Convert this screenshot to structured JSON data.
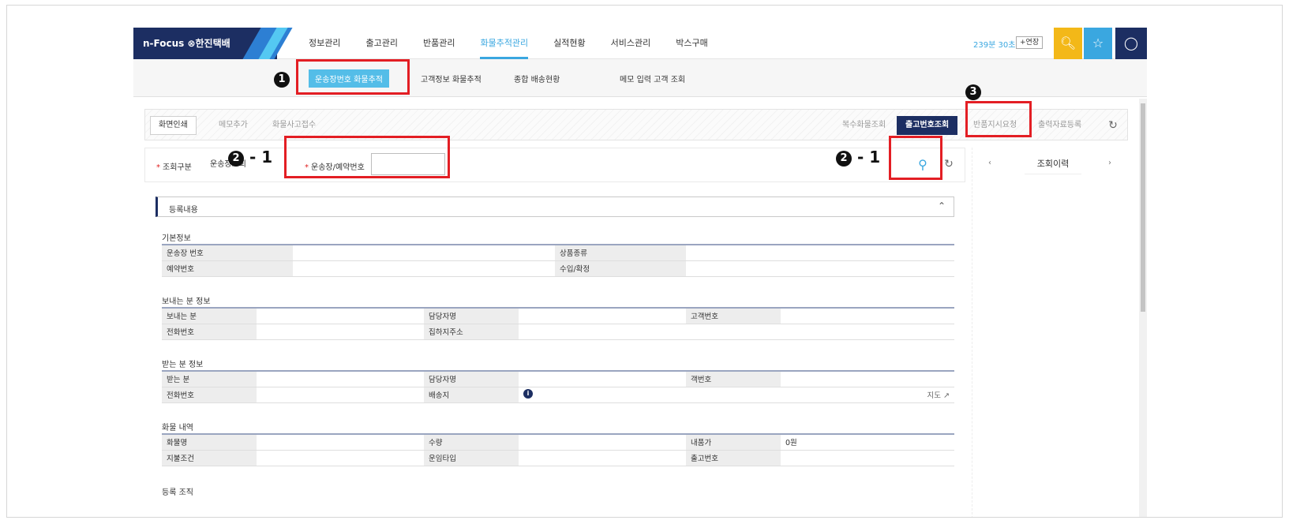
{
  "header": {
    "logo": "n-Focus ⊗한진택배",
    "nav": [
      "정보관리",
      "출고관리",
      "반품관리",
      "화물추적관리",
      "실적현황",
      "서비스관리",
      "박스구매"
    ],
    "active_nav": "화물추적관리",
    "session_timer": "239분 30초",
    "extend_label": "+연장",
    "icons": [
      "search-icon",
      "star-icon",
      "user-icon"
    ],
    "colors": {
      "navy": "#1c2e62",
      "sky": "#3aa7e0",
      "yellow": "#f3b818"
    }
  },
  "subnav": {
    "items": [
      "운송장번호 화물추적",
      "고객정보 화물추적",
      "종합 배송현황",
      "메모 입력 고객 조회"
    ]
  },
  "toolbar": {
    "left": [
      "화면인쇄",
      "메모추가",
      "화물사고접수"
    ],
    "right": [
      "복수화물조회",
      "출고번호조회",
      "반품지시요청",
      "출력자료등록"
    ]
  },
  "search": {
    "type_label": "조회구분",
    "type_value": "운송장조회",
    "waybill_label": "운송장/예약번호",
    "waybill_value": ""
  },
  "right_panel": {
    "history_label": "조회이력"
  },
  "content": {
    "section_title": "등록내용",
    "groups": {
      "basic": {
        "title": "기본정보",
        "waybill": "운송장 번호",
        "product_type": "상품종류",
        "reservation": "예약번호",
        "import_confirm": "수입/확정"
      },
      "sender": {
        "title": "보내는 분 정보",
        "sender": "보내는 분",
        "manager": "담당자명",
        "customer_no": "고객번호",
        "phone": "전화번호",
        "pickup_addr": "집하지주소"
      },
      "receiver": {
        "title": "받는 분 정보",
        "receiver": "받는 분",
        "manager": "담당자명",
        "customer_no": "객번호",
        "phone": "전화번호",
        "delivery": "배송지",
        "map": "지도"
      },
      "cargo": {
        "title": "화물 내역",
        "name": "화물명",
        "qty": "수량",
        "price_label": "내품가",
        "price_value": "0원",
        "payment": "지불조건",
        "freight_type": "운임타입",
        "release_no": "출고번호"
      },
      "org": {
        "title": "등록 조직"
      }
    }
  },
  "annotations": {
    "m1": "1",
    "m2a": "2",
    "m2a_suffix": "- 1",
    "m2b": "2",
    "m2b_suffix": "- 1",
    "m3": "3"
  }
}
